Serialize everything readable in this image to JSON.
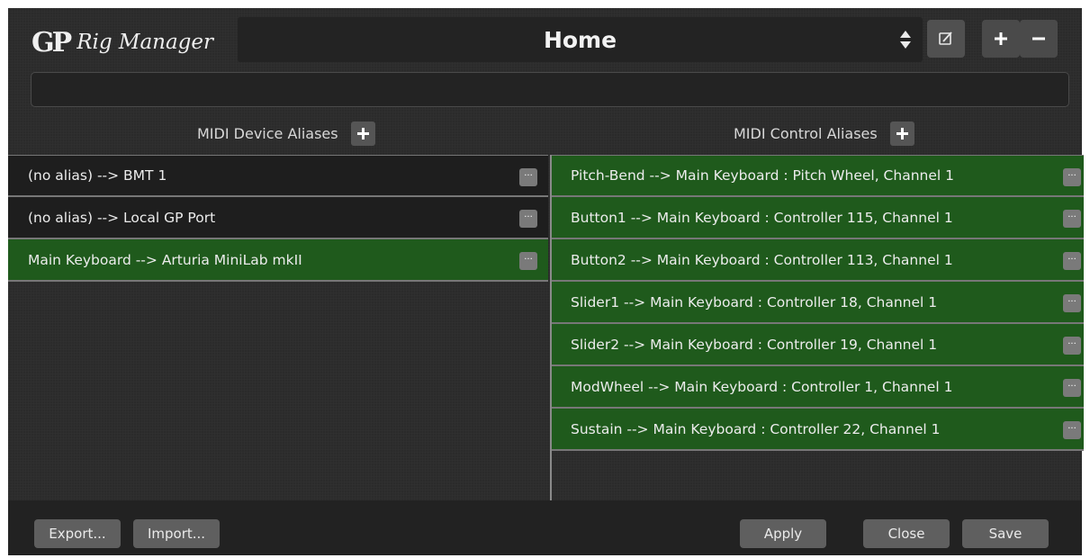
{
  "header": {
    "logo_mark": "GP",
    "app_title": "Rig Manager",
    "rig_name": "Home",
    "edit_icon": "edit-icon",
    "add_icon": "plus-icon",
    "remove_icon": "minus-icon"
  },
  "search": {
    "value": ""
  },
  "device_aliases": {
    "title": "MIDI Device Aliases",
    "items": [
      {
        "label": "(no alias) --> BMT 1",
        "selected": false
      },
      {
        "label": "(no alias) --> Local GP Port",
        "selected": false
      },
      {
        "label": "Main Keyboard --> Arturia MiniLab mkII",
        "selected": true
      }
    ]
  },
  "control_aliases": {
    "title": "MIDI Control Aliases",
    "items": [
      {
        "label": "Pitch-Bend --> Main Keyboard : Pitch Wheel, Channel 1"
      },
      {
        "label": "Button1 --> Main Keyboard : Controller 115, Channel 1"
      },
      {
        "label": "Button2 --> Main Keyboard : Controller 113, Channel 1"
      },
      {
        "label": "Slider1 --> Main Keyboard : Controller 18, Channel 1"
      },
      {
        "label": "Slider2 --> Main Keyboard : Controller 19, Channel 1"
      },
      {
        "label": "ModWheel --> Main Keyboard : Controller 1, Channel 1"
      },
      {
        "label": "Sustain --> Main Keyboard : Controller 22, Channel 1"
      }
    ]
  },
  "footer": {
    "export": "Export...",
    "import": "Import...",
    "apply": "Apply",
    "close": "Close",
    "save": "Save"
  },
  "more_label": "···",
  "colors": {
    "background": "#2b2b2b",
    "row_dark": "#1e1e1e",
    "row_selected": "#1f5a1c",
    "button": "#5f5f5f"
  }
}
